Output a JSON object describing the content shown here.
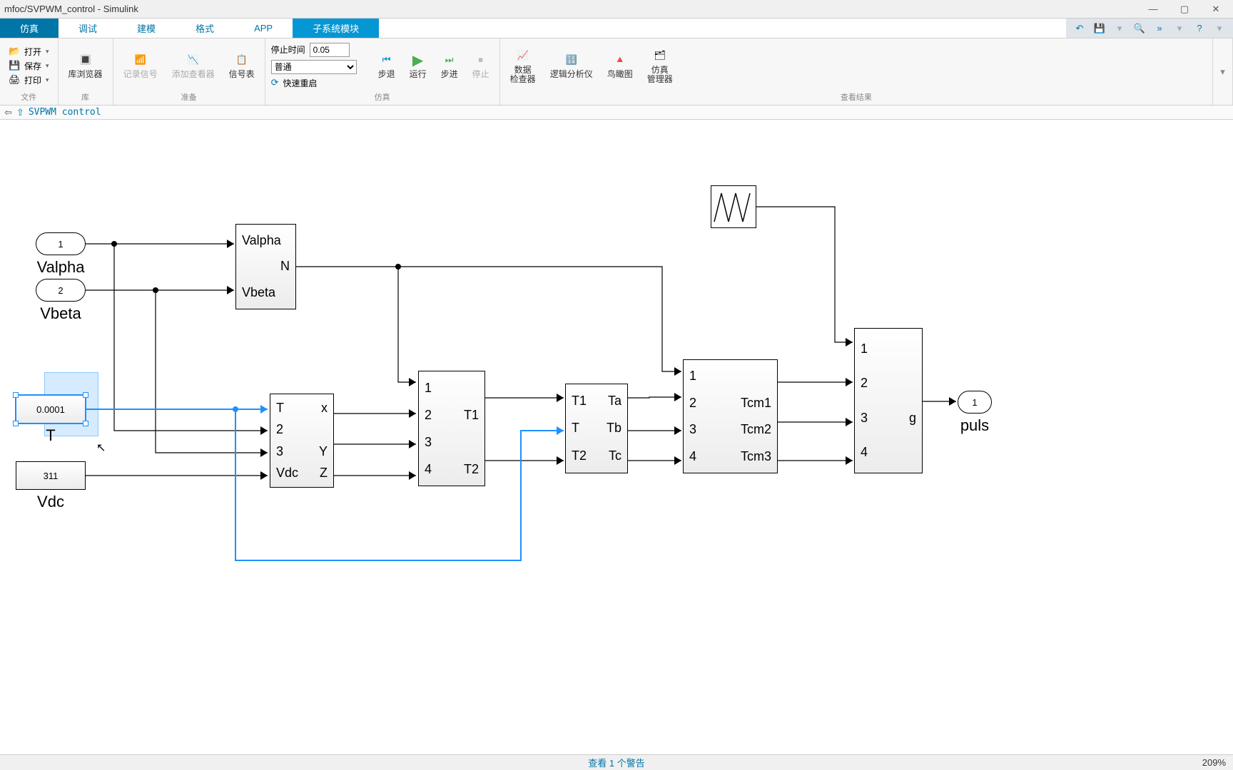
{
  "window": {
    "title": "mfoc/SVPWM_control - Simulink"
  },
  "tabs": {
    "sim": "仿真",
    "debug": "调试",
    "model": "建模",
    "format": "格式",
    "app": "APP",
    "subsys": "子系统模块"
  },
  "ribbon": {
    "file": {
      "open": "打开",
      "save": "保存",
      "print": "打印",
      "group": "文件"
    },
    "lib": {
      "browser": "库浏览器",
      "group": "库"
    },
    "prep": {
      "logsig": "记录信号",
      "addviewer": "添加查看器",
      "sigtable": "信号表",
      "group": "准备"
    },
    "sim": {
      "stoptime_label": "停止时间",
      "stoptime": "0.05",
      "mode": "普通",
      "restart": "快速重启",
      "stepback": "步退",
      "run": "运行",
      "stepfwd": "步进",
      "stop": "停止",
      "group": "仿真"
    },
    "results": {
      "datainsp": "数据\n检查器",
      "logic": "逻辑分析仪",
      "birdseye": "鸟瞰图",
      "simmgr": "仿真\n管理器",
      "group": "查看结果"
    }
  },
  "breadcrumb": {
    "path": "SVPWM control"
  },
  "blocks": {
    "in1": {
      "num": "1",
      "label": "Valpha"
    },
    "in2": {
      "num": "2",
      "label": "Vbeta"
    },
    "cT": {
      "value": "0.0001",
      "label": "T"
    },
    "cVdc": {
      "value": "311",
      "label": "Vdc"
    },
    "sector": {
      "in1": "Valpha",
      "in2": "Vbeta",
      "out": "N"
    },
    "xyz": {
      "i1": "T",
      "i2": "2",
      "i3": "3",
      "i4": "Vdc",
      "o1": "x",
      "o2": "Y",
      "o3": "Z"
    },
    "t1t2": {
      "i1": "1",
      "i2": "2",
      "i3": "3",
      "i4": "4",
      "o1": "T1",
      "o2": "T2"
    },
    "tabc": {
      "i1": "T1",
      "i2": "T",
      "i3": "T2",
      "o1": "Ta",
      "o2": "Tb",
      "o3": "Tc"
    },
    "tcm": {
      "i1": "1",
      "i2": "2",
      "i3": "3",
      "i4": "4",
      "o1": "Tcm1",
      "o2": "Tcm2",
      "o3": "Tcm3"
    },
    "cmp": {
      "i1": "1",
      "i2": "2",
      "i3": "3",
      "i4": "4",
      "o": "g"
    },
    "out": {
      "num": "1",
      "label": "puls"
    }
  },
  "status": {
    "warn": "查看 1 个警告",
    "zoom": "209%"
  }
}
